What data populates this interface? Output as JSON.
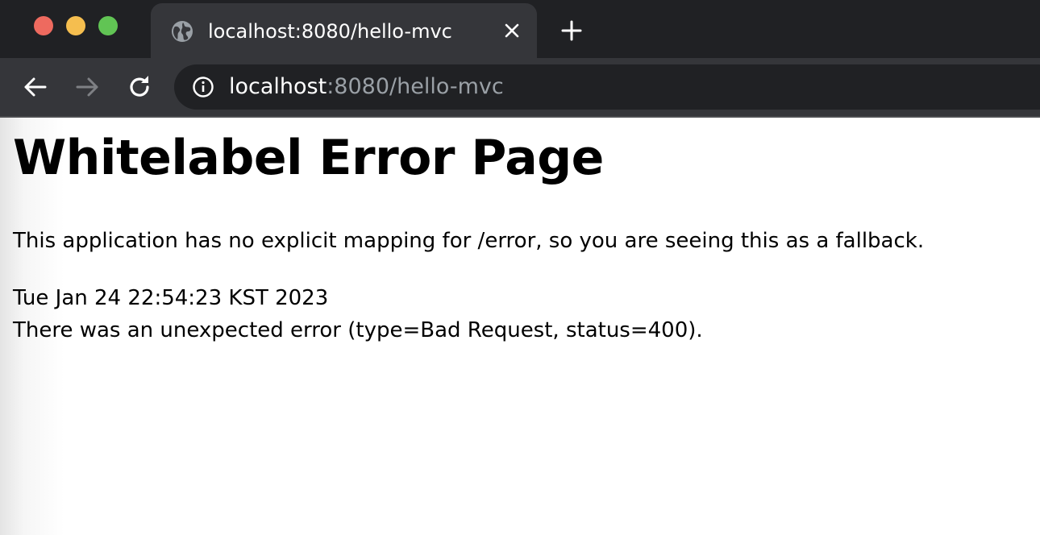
{
  "tab": {
    "title": "localhost:8080/hello-mvc",
    "favicon": "globe-icon"
  },
  "address_bar": {
    "host": "localhost",
    "rest": ":8080/hello-mvc",
    "info_icon": "info-icon"
  },
  "nav": {
    "back_icon": "arrow-left-icon",
    "forward_icon": "arrow-right-icon",
    "reload_icon": "reload-icon",
    "new_tab_icon": "plus-icon",
    "close_tab_icon": "close-icon"
  },
  "page": {
    "heading": "Whitelabel Error Page",
    "message": "This application has no explicit mapping for /error, so you are seeing this as a fallback.",
    "timestamp": "Tue Jan 24 22:54:23 KST 2023",
    "error": "There was an unexpected error (type=Bad Request, status=400)."
  },
  "colors": {
    "tabstrip": "#202124",
    "toolbar": "#35363a",
    "close_button": "#ee6a5f",
    "minimize_button": "#f5be4f",
    "zoom_button": "#61c454"
  }
}
